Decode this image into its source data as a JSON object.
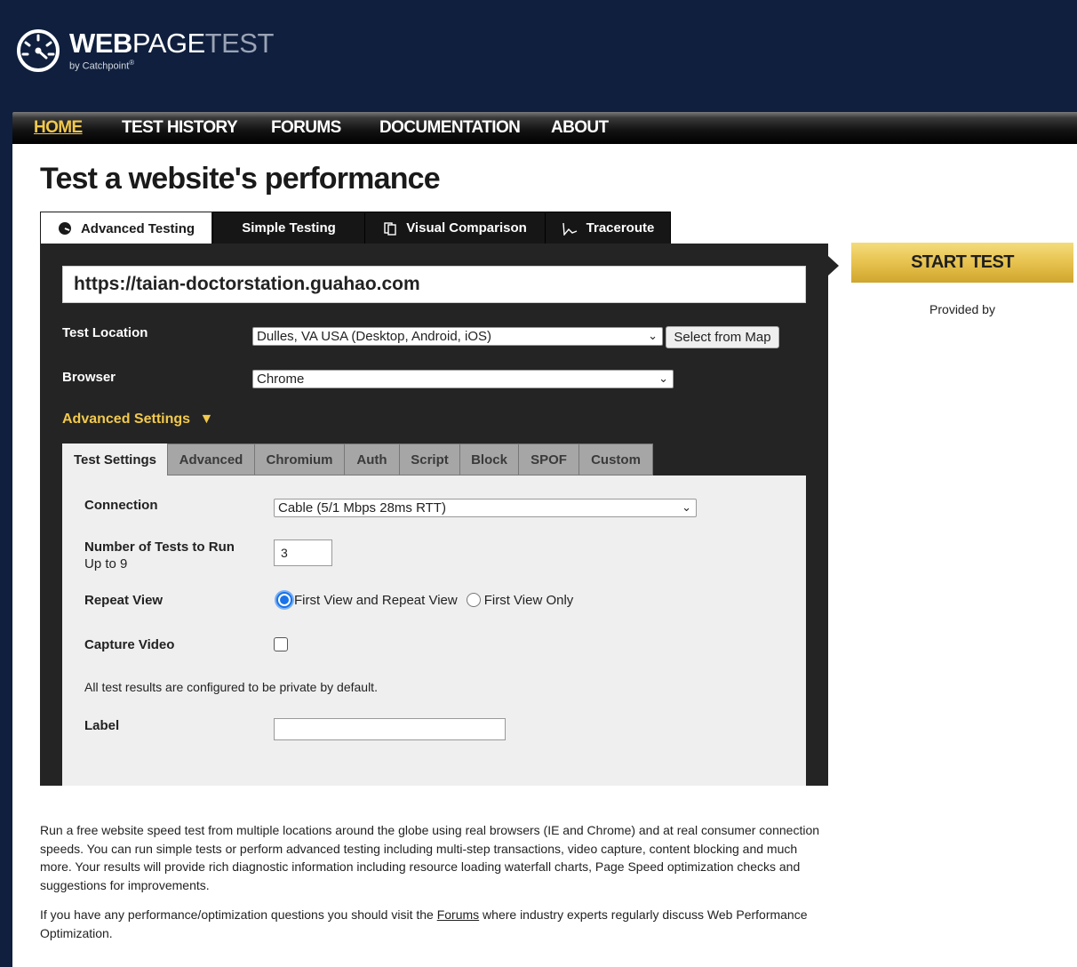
{
  "header": {
    "logo_bold": "WEB",
    "logo_mid": "PAGE",
    "logo_light": "TEST",
    "logo_by": "by Catchpoint",
    "logo_reg": "®"
  },
  "nav": [
    {
      "label": "HOME",
      "active": true
    },
    {
      "label": "TEST HISTORY"
    },
    {
      "label": "FORUMS"
    },
    {
      "label": "DOCUMENTATION"
    },
    {
      "label": "ABOUT"
    }
  ],
  "page_title": "Test a website's performance",
  "tabs": [
    {
      "label": "Advanced Testing",
      "icon": "gauge-icon",
      "active": true
    },
    {
      "label": "Simple Testing"
    },
    {
      "label": "Visual Comparison",
      "icon": "copy-icon"
    },
    {
      "label": "Traceroute",
      "icon": "trace-icon"
    }
  ],
  "form": {
    "url": "https://taian-doctorstation.guahao.com",
    "test_location_label": "Test Location",
    "test_location_value": "Dulles, VA USA (Desktop, Android, iOS)",
    "select_from_map": "Select from Map",
    "browser_label": "Browser",
    "browser_value": "Chrome",
    "advanced_settings": "Advanced Settings",
    "advanced_arrow": "▼"
  },
  "subtabs": [
    {
      "label": "Test Settings",
      "active": true
    },
    {
      "label": "Advanced"
    },
    {
      "label": "Chromium"
    },
    {
      "label": "Auth"
    },
    {
      "label": "Script"
    },
    {
      "label": "Block"
    },
    {
      "label": "SPOF"
    },
    {
      "label": "Custom"
    }
  ],
  "settings": {
    "connection_label": "Connection",
    "connection_value": "Cable (5/1 Mbps 28ms RTT)",
    "num_tests_label": "Number of Tests to Run",
    "num_tests_hint": "Up to 9",
    "num_tests_value": "3",
    "repeat_view_label": "Repeat View",
    "repeat_opt1": "First View and Repeat View",
    "repeat_opt2": "First View Only",
    "capture_video_label": "Capture Video",
    "private_note": "All test results are configured to be private by default.",
    "label_label": "Label",
    "label_value": ""
  },
  "sidebar": {
    "start_test": "START TEST",
    "provided_by": "Provided by"
  },
  "description": {
    "para1": "Run a free website speed test from multiple locations around the globe using real browsers (IE and Chrome) and at real consumer connection speeds. You can run simple tests or perform advanced testing including multi-step transactions, video capture, content blocking and much more. Your results will provide rich diagnostic information including resource loading waterfall charts, Page Speed optimization checks and suggestions for improvements.",
    "para2_before": "If you have any performance/optimization questions you should visit the ",
    "para2_link": "Forums",
    "para2_after": " where industry experts regularly discuss Web Performance Optimization."
  },
  "colors": {
    "header_bg": "#0f1f3d",
    "accent": "#f2c94c",
    "panel_bg": "#242424"
  }
}
